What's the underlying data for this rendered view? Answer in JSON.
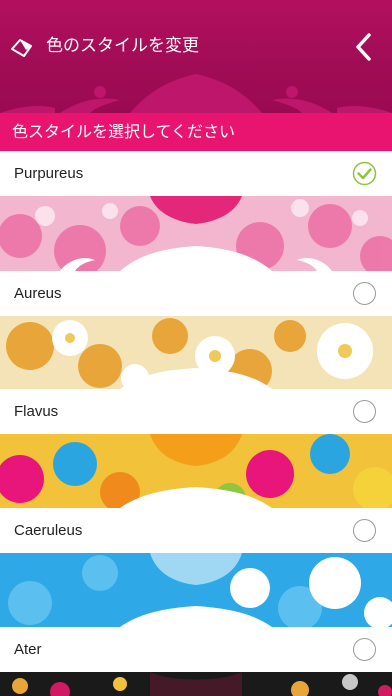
{
  "header": {
    "title": "色のスタイルを変更",
    "icon": "palette-icon",
    "back_icon": "chevron-left-icon"
  },
  "section": {
    "title": "色スタイルを選択してください"
  },
  "styles": [
    {
      "name": "Purpureus",
      "selected": true
    },
    {
      "name": "Aureus",
      "selected": false
    },
    {
      "name": "Flavus",
      "selected": false
    },
    {
      "name": "Caeruleus",
      "selected": false
    },
    {
      "name": "Ater",
      "selected": false
    }
  ],
  "colors": {
    "header": "#a40d57",
    "section_bar": "#e8146f",
    "check": "#8cc63f"
  }
}
